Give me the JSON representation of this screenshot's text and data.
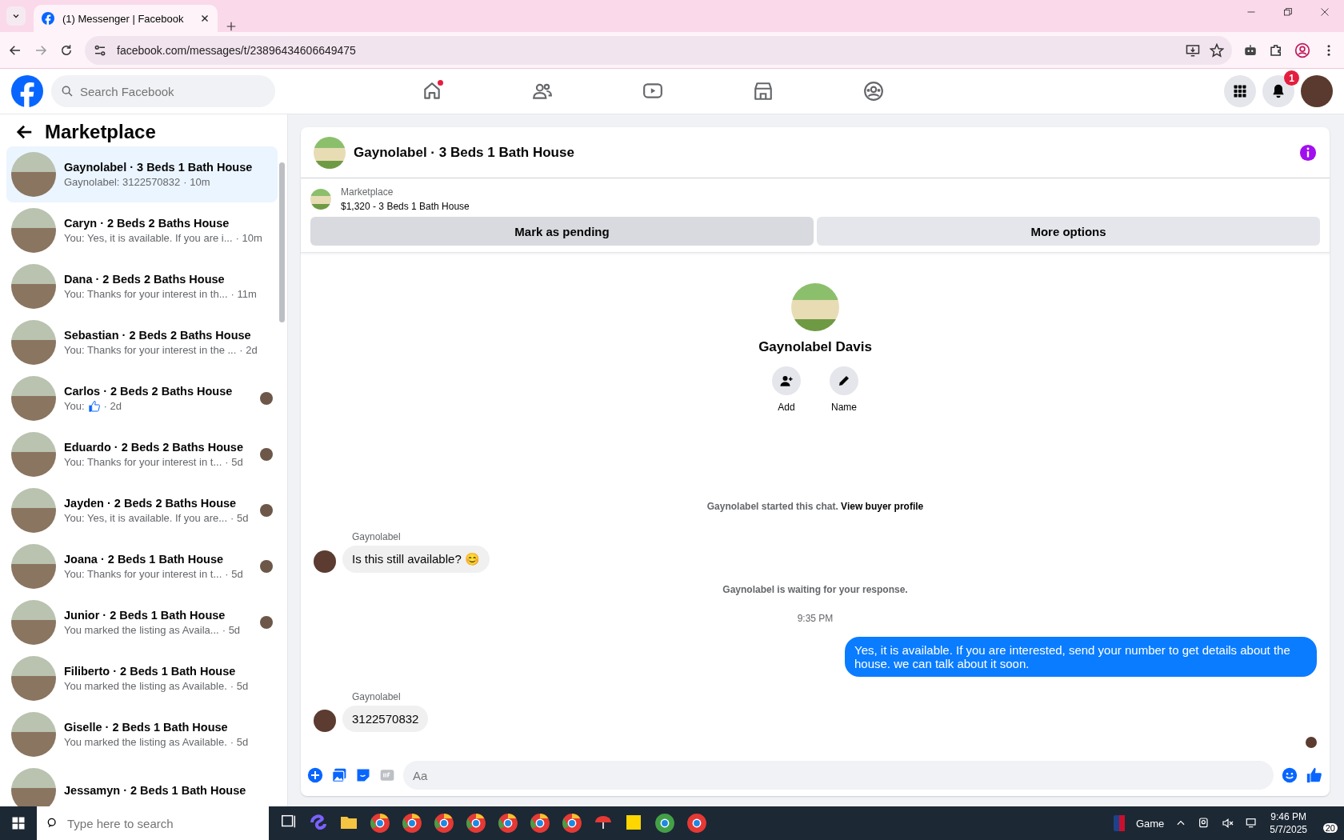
{
  "browser": {
    "tab_title": "(1) Messenger | Facebook",
    "url": "facebook.com/messages/t/23896434606649475"
  },
  "header": {
    "search_placeholder": "Search Facebook",
    "nav": [
      {
        "kind": "home",
        "dot": true
      },
      {
        "kind": "friends",
        "dot": false
      },
      {
        "kind": "video",
        "dot": false
      },
      {
        "kind": "marketplace",
        "dot": false
      },
      {
        "kind": "groups",
        "dot": false
      }
    ],
    "notification_count": "1"
  },
  "sidebar": {
    "title": "Marketplace",
    "conversations": [
      {
        "name": "Gaynolabel · 3 Beds 1 Bath House",
        "preview": "Gaynolabel: 3122570832",
        "time": "· 10m",
        "kind": "text",
        "seen_avatar": false,
        "selected": true
      },
      {
        "name": "Caryn · 2 Beds 2 Baths House",
        "preview": "You: Yes, it is available. If you are i...",
        "time": "· 10m",
        "kind": "text",
        "seen_avatar": false,
        "selected": false
      },
      {
        "name": "Dana · 2 Beds 2 Baths House",
        "preview": "You: Thanks for your interest in th...",
        "time": "· 11m",
        "kind": "text",
        "seen_avatar": false,
        "selected": false
      },
      {
        "name": "Sebastian · 2 Beds 2 Baths House",
        "preview": "You: Thanks for your interest in the ...",
        "time": "· 2d",
        "kind": "text",
        "seen_avatar": false,
        "selected": false
      },
      {
        "name": "Carlos · 2 Beds 2 Baths House",
        "preview": "You:",
        "time": "· 2d",
        "kind": "like",
        "seen_avatar": true,
        "selected": false
      },
      {
        "name": "Eduardo · 2 Beds 2 Baths House",
        "preview": "You: Thanks for your interest in t...",
        "time": "· 5d",
        "kind": "text",
        "seen_avatar": true,
        "selected": false
      },
      {
        "name": "Jayden · 2 Beds 2 Baths House",
        "preview": "You: Yes, it is available. If you are...",
        "time": "· 5d",
        "kind": "text",
        "seen_avatar": true,
        "selected": false
      },
      {
        "name": "Joana · 2 Beds 1 Bath House",
        "preview": "You: Thanks for your interest in t...",
        "time": "· 5d",
        "kind": "text",
        "seen_avatar": true,
        "selected": false
      },
      {
        "name": "Junior · 2 Beds 1 Bath House",
        "preview": "You marked the listing as Availa...",
        "time": "· 5d",
        "kind": "text",
        "seen_avatar": true,
        "selected": false
      },
      {
        "name": "Filiberto · 2 Beds 1 Bath House",
        "preview": "You marked the listing as Available.",
        "time": "· 5d",
        "kind": "text",
        "seen_avatar": false,
        "selected": false
      },
      {
        "name": "Giselle · 2 Beds 1 Bath House",
        "preview": "You marked the listing as Available.",
        "time": "· 5d",
        "kind": "text",
        "seen_avatar": false,
        "selected": false
      },
      {
        "name": "Jessamyn · 2 Beds 1 Bath House",
        "kind": "text",
        "seen_avatar": false,
        "selected": false
      }
    ]
  },
  "chat": {
    "title": "Gaynolabel · 3 Beds 1 Bath House",
    "listing": {
      "source": "Marketplace",
      "summary": "$1,320 - 3 Beds 1 Bath House"
    },
    "buttons": [
      "Mark as pending",
      "More options"
    ],
    "profile": {
      "name": "Gaynolabel Davis",
      "actions": [
        {
          "kind": "add",
          "label": "Add"
        },
        {
          "kind": "name",
          "label": "Name"
        }
      ]
    },
    "messages": [
      {
        "kind": "system",
        "text": "Gaynolabel started this chat.",
        "link": "View buyer profile"
      },
      {
        "kind": "incoming",
        "sender": "Gaynolabel",
        "text": "Is this still available? 😊"
      },
      {
        "kind": "system",
        "text": "Gaynolabel is waiting for your response."
      },
      {
        "kind": "time",
        "text": "9:35 PM"
      },
      {
        "kind": "outgoing",
        "text": "Yes, it is available. If you are interested, send your number to get details about the house. we can talk about it soon."
      },
      {
        "kind": "incoming",
        "sender": "Gaynolabel",
        "text": "3122570832"
      },
      {
        "kind": "seen"
      }
    ],
    "composer_placeholder": "Aa"
  },
  "taskbar": {
    "search_placeholder": "Type here to search",
    "weather": "Game",
    "time": "9:46 PM",
    "date": "5/7/2025",
    "notifications": "20"
  }
}
